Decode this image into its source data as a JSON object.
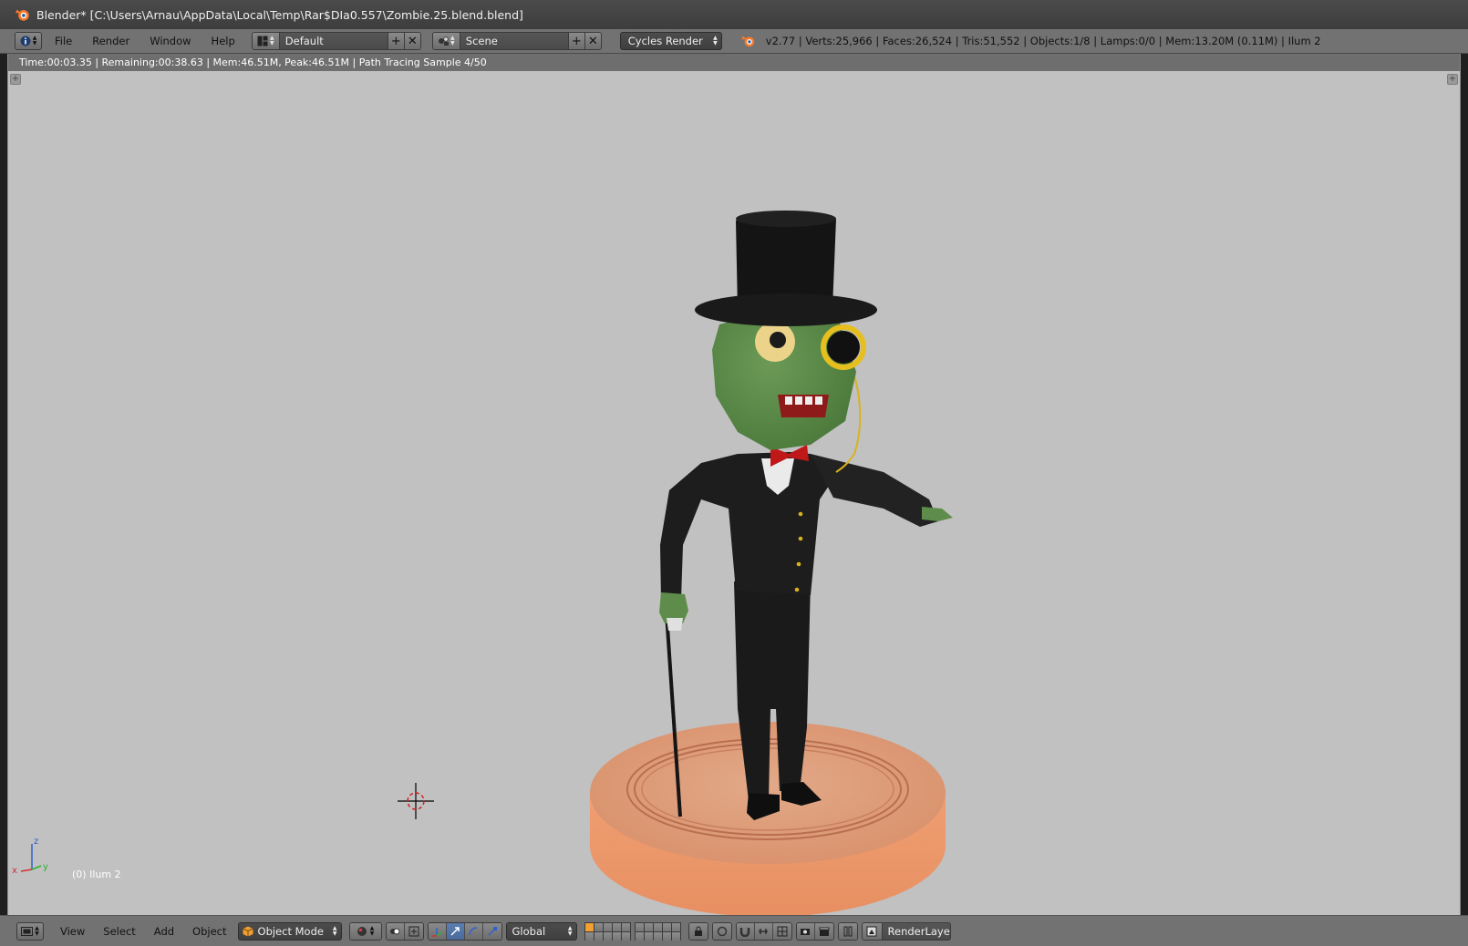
{
  "window": {
    "title": "Blender* [C:\\Users\\Arnau\\AppData\\Local\\Temp\\Rar$DIa0.557\\Zombie.25.blend.blend]"
  },
  "info_header": {
    "menus": [
      "File",
      "Render",
      "Window",
      "Help"
    ],
    "screen_layout": "Default",
    "scene": "Scene",
    "render_engine": "Cycles Render",
    "stats": "v2.77 | Verts:25,966 | Faces:26,524 | Tris:51,552 | Objects:1/8 | Lamps:0/0 | Mem:13.20M (0.11M) | Ilum 2"
  },
  "viewport": {
    "render_status": "Time:00:03.35 | Remaining:00:38.63 | Mem:46.51M, Peak:46.51M | Path Tracing Sample 4/50",
    "object_label": "(0) Ilum 2",
    "axis_labels": {
      "x": "x",
      "y": "y",
      "z": "z"
    },
    "scene_colors": {
      "background": "#c1c1c1",
      "suit": "#1c1c1c",
      "skin": "#5e8c4a",
      "bowtie": "#c01818",
      "gold": "#d9b21f",
      "pedestal": "#e89a72"
    }
  },
  "view3d_header": {
    "menus": [
      "View",
      "Select",
      "Add",
      "Object"
    ],
    "mode": "Object Mode",
    "orientation": "Global",
    "render_layer": "RenderLayer"
  }
}
